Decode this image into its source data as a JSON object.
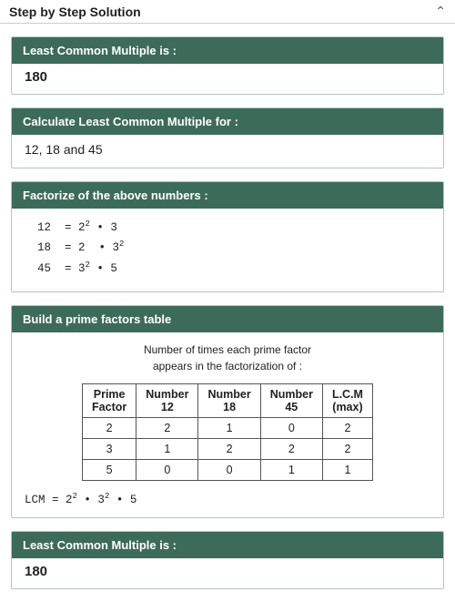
{
  "header": {
    "title": "Step by Step Solution",
    "chevron": "^"
  },
  "sections": {
    "lcm_result_top": {
      "header": "Least Common Multiple is :",
      "value": "180"
    },
    "calculate": {
      "header": "Calculate Least Common Multiple for :",
      "numbers": "12, 18 and 45"
    },
    "factorize": {
      "header": "Factorize of the above numbers :",
      "rows": [
        {
          "num": "12",
          "eq": "2",
          "exp1": "2",
          "dot1": " • ",
          "val1": "3",
          "exp2": "",
          "dot2": "",
          "val2": ""
        },
        {
          "num": "18",
          "eq": "2",
          "exp1": "",
          "dot1": " • ",
          "val1": "3",
          "exp2": "2",
          "dot2": "",
          "val2": ""
        },
        {
          "num": "45",
          "eq": "3",
          "exp1": "2",
          "dot1": " • ",
          "val1": "5",
          "exp2": "",
          "dot2": "",
          "val2": ""
        }
      ]
    },
    "prime_table": {
      "header": "Build a prime factors table",
      "intro_line1": "Number of times each prime factor",
      "intro_line2": "appears in the factorization of :",
      "columns": [
        "Prime Factor",
        "Number 12",
        "Number 18",
        "Number 45",
        "L.C.M (max)"
      ],
      "col_headers": [
        "Prime\nFactor",
        "Number\n12",
        "Number\n18",
        "Number\n45",
        "L.C.M\n(max)"
      ],
      "rows": [
        [
          "2",
          "2",
          "1",
          "0",
          "2"
        ],
        [
          "3",
          "1",
          "2",
          "2",
          "2"
        ],
        [
          "5",
          "0",
          "0",
          "1",
          "1"
        ]
      ],
      "lcm_formula": "LCM = 2² • 3² • 5"
    },
    "lcm_result_bottom": {
      "header": "Least Common Multiple is :",
      "value": "180"
    }
  }
}
